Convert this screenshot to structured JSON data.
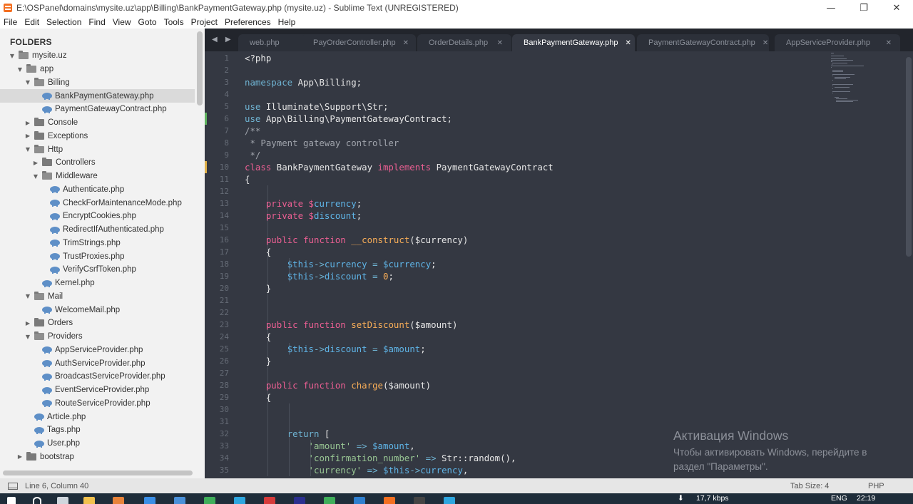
{
  "window": {
    "title": "E:\\OSPanel\\domains\\mysite.uz\\app\\Billing\\BankPaymentGateway.php (mysite.uz) - Sublime Text (UNREGISTERED)",
    "minimize_glyph": "—",
    "restore_glyph": "❐",
    "close_glyph": "✕"
  },
  "menu": [
    "File",
    "Edit",
    "Selection",
    "Find",
    "View",
    "Goto",
    "Tools",
    "Project",
    "Preferences",
    "Help"
  ],
  "sidebar": {
    "title": "FOLDERS",
    "tree": [
      {
        "label": "mysite.uz",
        "type": "folder",
        "open": true,
        "depth": 0
      },
      {
        "label": "app",
        "type": "folder",
        "open": true,
        "depth": 1
      },
      {
        "label": "Billing",
        "type": "folder",
        "open": true,
        "depth": 2
      },
      {
        "label": "BankPaymentGateway.php",
        "type": "file",
        "depth": 3,
        "selected": true
      },
      {
        "label": "PaymentGatewayContract.php",
        "type": "file",
        "depth": 3
      },
      {
        "label": "Console",
        "type": "folder",
        "open": false,
        "depth": 2
      },
      {
        "label": "Exceptions",
        "type": "folder",
        "open": false,
        "depth": 2
      },
      {
        "label": "Http",
        "type": "folder",
        "open": true,
        "depth": 2
      },
      {
        "label": "Controllers",
        "type": "folder",
        "open": false,
        "depth": 3
      },
      {
        "label": "Middleware",
        "type": "folder",
        "open": true,
        "depth": 3
      },
      {
        "label": "Authenticate.php",
        "type": "file",
        "depth": 4
      },
      {
        "label": "CheckForMaintenanceMode.php",
        "type": "file",
        "depth": 4
      },
      {
        "label": "EncryptCookies.php",
        "type": "file",
        "depth": 4
      },
      {
        "label": "RedirectIfAuthenticated.php",
        "type": "file",
        "depth": 4
      },
      {
        "label": "TrimStrings.php",
        "type": "file",
        "depth": 4
      },
      {
        "label": "TrustProxies.php",
        "type": "file",
        "depth": 4
      },
      {
        "label": "VerifyCsrfToken.php",
        "type": "file",
        "depth": 4
      },
      {
        "label": "Kernel.php",
        "type": "file",
        "depth": 3
      },
      {
        "label": "Mail",
        "type": "folder",
        "open": true,
        "depth": 2
      },
      {
        "label": "WelcomeMail.php",
        "type": "file",
        "depth": 3
      },
      {
        "label": "Orders",
        "type": "folder",
        "open": false,
        "depth": 2
      },
      {
        "label": "Providers",
        "type": "folder",
        "open": true,
        "depth": 2
      },
      {
        "label": "AppServiceProvider.php",
        "type": "file",
        "depth": 3
      },
      {
        "label": "AuthServiceProvider.php",
        "type": "file",
        "depth": 3
      },
      {
        "label": "BroadcastServiceProvider.php",
        "type": "file",
        "depth": 3
      },
      {
        "label": "EventServiceProvider.php",
        "type": "file",
        "depth": 3
      },
      {
        "label": "RouteServiceProvider.php",
        "type": "file",
        "depth": 3
      },
      {
        "label": "Article.php",
        "type": "file",
        "depth": 2
      },
      {
        "label": "Tags.php",
        "type": "file",
        "depth": 2
      },
      {
        "label": "User.php",
        "type": "file",
        "depth": 2
      },
      {
        "label": "bootstrap",
        "type": "folder",
        "open": false,
        "depth": 1
      }
    ]
  },
  "tabs": {
    "arrows": "◀ ▶",
    "items": [
      {
        "label": "web.php",
        "active": false
      },
      {
        "label": "PayOrderController.php",
        "active": false
      },
      {
        "label": "OrderDetails.php",
        "active": false
      },
      {
        "label": "BankPaymentGateway.php",
        "active": true
      },
      {
        "label": "PaymentGatewayContract.php",
        "active": false
      },
      {
        "label": "AppServiceProvider.php",
        "active": false
      }
    ],
    "close_glyph": "✕"
  },
  "editor": {
    "line_numbers": [
      "1",
      "2",
      "3",
      "4",
      "5",
      "6",
      "7",
      "8",
      "9",
      "10",
      "11",
      "12",
      "13",
      "14",
      "15",
      "16",
      "17",
      "18",
      "19",
      "20",
      "21",
      "22",
      "23",
      "24",
      "25",
      "26",
      "27",
      "28",
      "29",
      "30",
      "31",
      "32",
      "33",
      "34",
      "35"
    ],
    "modified_lines": [
      {
        "line": 6,
        "color": "#5fb35f"
      },
      {
        "line": 10,
        "color": "#e0b14a"
      }
    ],
    "lines": [
      [
        [
          "",
          "<?php"
        ]
      ],
      [],
      [
        [
          "ns",
          "namespace"
        ],
        [
          "",
          " App\\Billing;"
        ]
      ],
      [],
      [
        [
          "ns",
          "use"
        ],
        [
          "",
          " Illuminate\\Support\\Str;"
        ]
      ],
      [
        [
          "ns",
          "use"
        ],
        [
          "",
          " App\\Billing\\PaymentGatewayContract;"
        ]
      ],
      [
        [
          "cm",
          "/**"
        ]
      ],
      [
        [
          "cm",
          " * Payment gateway controller"
        ]
      ],
      [
        [
          "cm",
          " */"
        ]
      ],
      [
        [
          "kw",
          "class"
        ],
        [
          "",
          " BankPaymentGateway "
        ],
        [
          "kw",
          "implements"
        ],
        [
          "",
          " PaymentGatewayContract"
        ]
      ],
      [
        [
          "",
          "{"
        ]
      ],
      [],
      [
        [
          "",
          "    "
        ],
        [
          "kw",
          "private"
        ],
        [
          "",
          " "
        ],
        [
          "var-d",
          "$"
        ],
        [
          "var",
          "currency"
        ],
        [
          "",
          ";"
        ]
      ],
      [
        [
          "",
          "    "
        ],
        [
          "kw",
          "private"
        ],
        [
          "",
          " "
        ],
        [
          "var-d",
          "$"
        ],
        [
          "var",
          "discount"
        ],
        [
          "",
          ";"
        ]
      ],
      [],
      [
        [
          "",
          "    "
        ],
        [
          "kw",
          "public"
        ],
        [
          "",
          " "
        ],
        [
          "kw",
          "function"
        ],
        [
          "",
          " "
        ],
        [
          "fn",
          "__construct"
        ],
        [
          "",
          "($currency)"
        ]
      ],
      [
        [
          "",
          "    {"
        ]
      ],
      [
        [
          "",
          "        "
        ],
        [
          "var",
          "$this"
        ],
        [
          "op",
          "->"
        ],
        [
          "var",
          "currency"
        ],
        [
          "",
          " "
        ],
        [
          "op",
          "="
        ],
        [
          "",
          " "
        ],
        [
          "var",
          "$currency"
        ],
        [
          "",
          ";"
        ]
      ],
      [
        [
          "",
          "        "
        ],
        [
          "var",
          "$this"
        ],
        [
          "op",
          "->"
        ],
        [
          "var",
          "discount"
        ],
        [
          "",
          " "
        ],
        [
          "op",
          "="
        ],
        [
          "",
          " "
        ],
        [
          "num",
          "0"
        ],
        [
          "",
          ";"
        ]
      ],
      [
        [
          "",
          "    }"
        ]
      ],
      [],
      [],
      [
        [
          "",
          "    "
        ],
        [
          "kw",
          "public"
        ],
        [
          "",
          " "
        ],
        [
          "kw",
          "function"
        ],
        [
          "",
          " "
        ],
        [
          "fn",
          "setDiscount"
        ],
        [
          "",
          "($amount)"
        ]
      ],
      [
        [
          "",
          "    {"
        ]
      ],
      [
        [
          "",
          "        "
        ],
        [
          "var",
          "$this"
        ],
        [
          "op",
          "->"
        ],
        [
          "var",
          "discount"
        ],
        [
          "",
          " "
        ],
        [
          "op",
          "="
        ],
        [
          "",
          " "
        ],
        [
          "var",
          "$amount"
        ],
        [
          "",
          ";"
        ]
      ],
      [
        [
          "",
          "    }"
        ]
      ],
      [],
      [
        [
          "",
          "    "
        ],
        [
          "kw",
          "public"
        ],
        [
          "",
          " "
        ],
        [
          "kw",
          "function"
        ],
        [
          "",
          " "
        ],
        [
          "fn",
          "charge"
        ],
        [
          "",
          "($amount)"
        ]
      ],
      [
        [
          "",
          "    {"
        ]
      ],
      [],
      [],
      [
        [
          "",
          "        "
        ],
        [
          "ns",
          "return"
        ],
        [
          "",
          " ["
        ]
      ],
      [
        [
          "",
          "            "
        ],
        [
          "str",
          "'amount'"
        ],
        [
          "",
          " "
        ],
        [
          "op",
          "=>"
        ],
        [
          "",
          " "
        ],
        [
          "var",
          "$amount"
        ],
        [
          "",
          ","
        ]
      ],
      [
        [
          "",
          "            "
        ],
        [
          "str",
          "'confirmation_number'"
        ],
        [
          "",
          " "
        ],
        [
          "op",
          "=>"
        ],
        [
          "",
          " Str::random(),"
        ]
      ],
      [
        [
          "",
          "            "
        ],
        [
          "str",
          "'currency'"
        ],
        [
          "",
          " "
        ],
        [
          "op",
          "=>"
        ],
        [
          "",
          " "
        ],
        [
          "var",
          "$this"
        ],
        [
          "op",
          "->"
        ],
        [
          "var",
          "currency"
        ],
        [
          "",
          ","
        ]
      ]
    ]
  },
  "watermark": {
    "title": "Активация Windows",
    "line1": "Чтобы активировать Windows, перейдите в",
    "line2": "раздел \"Параметры\"."
  },
  "status": {
    "position": "Line 6, Column 40",
    "tab_size": "Tab Size: 4",
    "syntax": "PHP"
  },
  "taskbar": {
    "speed": "17,7 kbps",
    "lang": "ENG",
    "time": "22:19"
  },
  "colors": {
    "editor_bg": "#343842",
    "sidebar_bg": "#f2f2f2",
    "tabbar_bg": "#22252c",
    "keyword": "#ec5f93",
    "function": "#f9ae58",
    "string": "#99c794",
    "variable": "#5fb5e8",
    "comment": "#a0a4ac"
  }
}
